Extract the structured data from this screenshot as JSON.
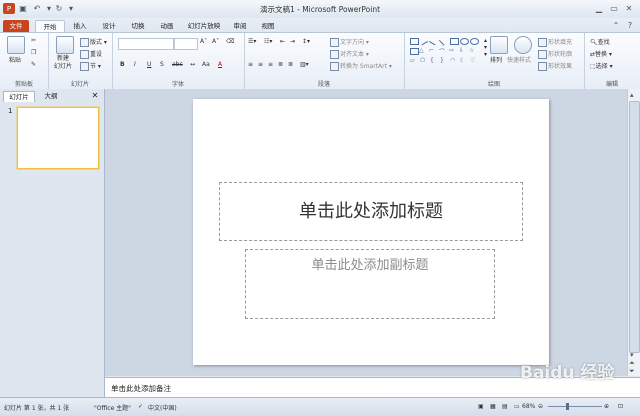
{
  "window": {
    "title": "演示文稿1 - Microsoft PowerPoint"
  },
  "tabs": [
    "文件",
    "开始",
    "插入",
    "设计",
    "切换",
    "动画",
    "幻灯片放映",
    "审阅",
    "视图"
  ],
  "ribbon": {
    "clipboard": {
      "paste": "粘贴",
      "label": "剪贴板"
    },
    "slides": {
      "new_slide": "新建\n幻灯片",
      "layout": "版式",
      "reset": "重设",
      "section": "节",
      "label": "幻灯片"
    },
    "font": {
      "label": "字体",
      "buttons": [
        "B",
        "I",
        "U",
        "S",
        "abc",
        "A",
        "Aa",
        "A"
      ]
    },
    "paragraph": {
      "text_direction": "文字方向",
      "align_text": "对齐文本",
      "smartart": "转换为 SmartArt",
      "label": "段落"
    },
    "drawing": {
      "arrange": "排列",
      "quick_styles": "快速样式",
      "shape_fill": "形状填充",
      "shape_outline": "形状轮廓",
      "shape_effects": "形状效果",
      "label": "绘图"
    },
    "editing": {
      "find": "查找",
      "replace": "替换",
      "select": "选择",
      "label": "编辑"
    }
  },
  "left_pane": {
    "tab_slides": "幻灯片",
    "tab_outline": "大纲",
    "slide_number": "1"
  },
  "slide": {
    "title_placeholder": "单击此处添加标题",
    "subtitle_placeholder": "单击此处添加副标题"
  },
  "notes": {
    "placeholder": "单击此处添加备注"
  },
  "status": {
    "slide_info": "幻灯片 第 1 张，共 1 张",
    "theme": "\"Office 主题\"",
    "language": "中文(中国)",
    "zoom": "68%"
  },
  "watermark": "Baidu 经验"
}
